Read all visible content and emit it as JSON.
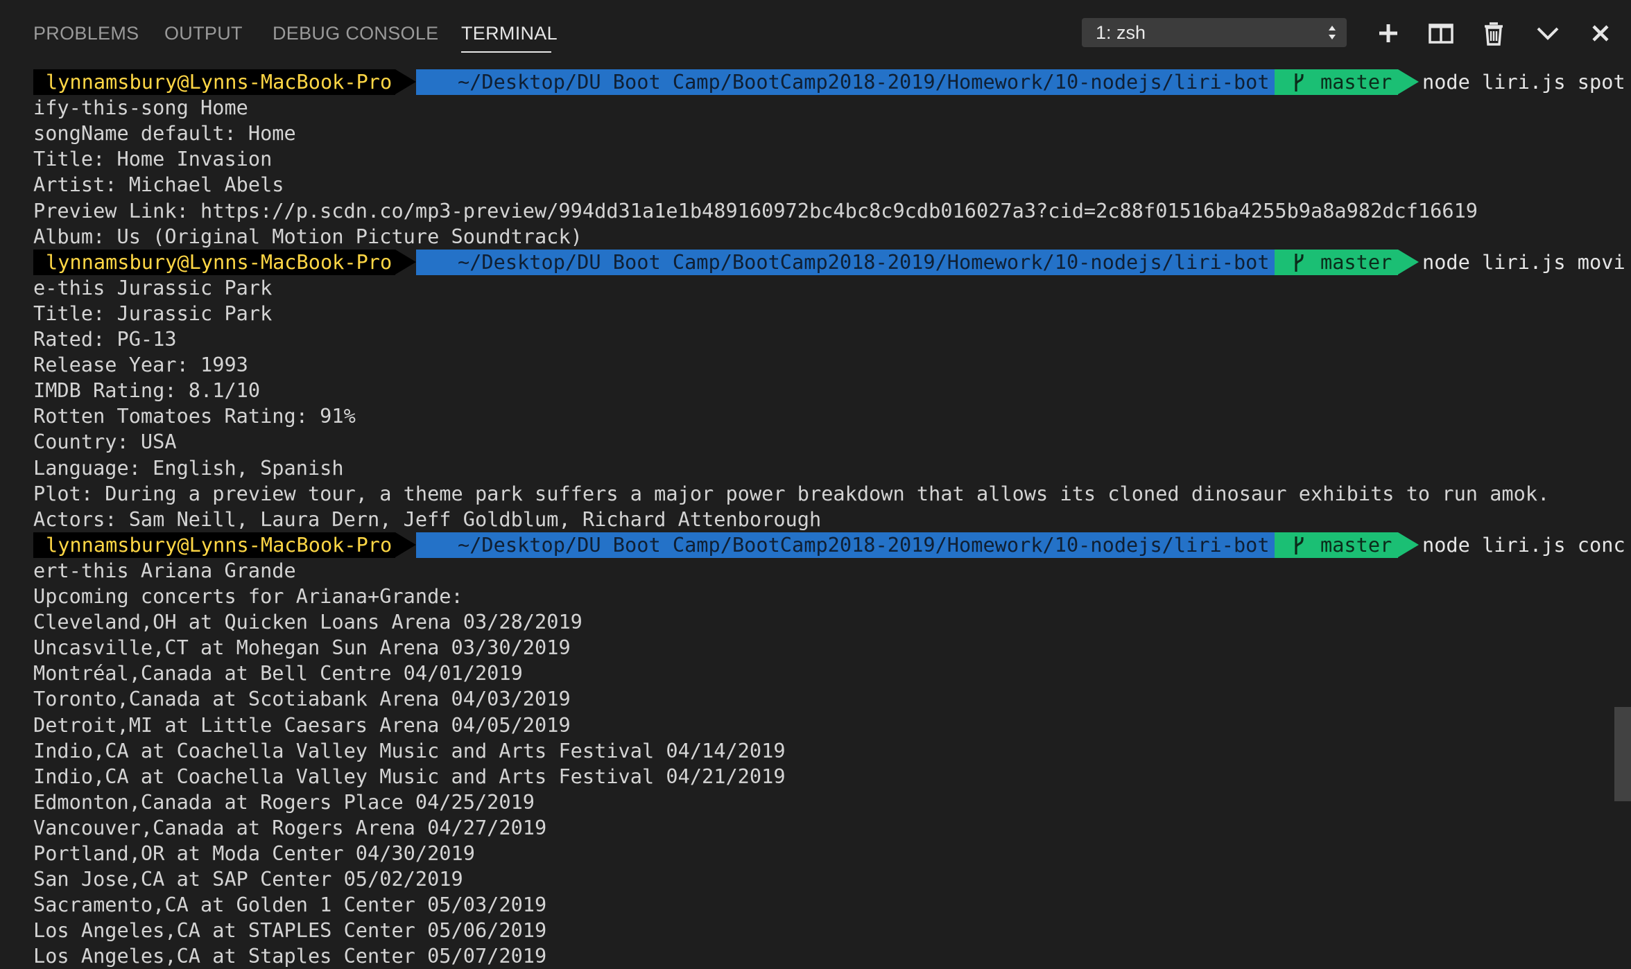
{
  "tabs": [
    {
      "label": "PROBLEMS",
      "active": false
    },
    {
      "label": "OUTPUT",
      "active": false
    },
    {
      "label": "DEBUG CONSOLE",
      "active": false
    },
    {
      "label": "TERMINAL",
      "active": true
    }
  ],
  "terminal_select": {
    "value": "1: zsh"
  },
  "toolbar_icons": [
    "plus-icon",
    "split-icon",
    "trash-icon",
    "chevron-down-icon",
    "close-icon"
  ],
  "prompt": {
    "user": "lynnamsbury@Lynns-MacBook-Pro",
    "path": "~/Desktop/DU Boot Camp/BootCamp2018-2019/Homework/10-nodejs/liri-bot",
    "branch": "master"
  },
  "colors": {
    "background": "#1e1e1e",
    "user_segment": "#000000",
    "user_text": "#ffd745",
    "path_segment": "#2472c8",
    "git_segment": "#1bbf74"
  },
  "blocks": [
    {
      "command": "node liri.js spot",
      "lines": [
        "ify-this-song Home",
        "songName default: Home",
        "Title: Home Invasion",
        "Artist: Michael Abels",
        "Preview Link: https://p.scdn.co/mp3-preview/994dd31a1e1b489160972bc4bc8c9cdb016027a3?cid=2c88f01516ba4255b9a8a982dcf16619",
        "Album: Us (Original Motion Picture Soundtrack)"
      ]
    },
    {
      "command": "node liri.js movi",
      "lines": [
        "e-this Jurassic Park",
        "Title: Jurassic Park",
        "Rated: PG-13",
        "Release Year: 1993",
        "IMDB Rating: 8.1/10",
        "Rotten Tomatoes Rating: 91%",
        "Country: USA",
        "Language: English, Spanish",
        "Plot: During a preview tour, a theme park suffers a major power breakdown that allows its cloned dinosaur exhibits to run amok.",
        "Actors: Sam Neill, Laura Dern, Jeff Goldblum, Richard Attenborough"
      ]
    },
    {
      "command": "node liri.js conc",
      "lines": [
        "ert-this Ariana Grande",
        "Upcoming concerts for Ariana+Grande:",
        "Cleveland,OH at Quicken Loans Arena 03/28/2019",
        "Uncasville,CT at Mohegan Sun Arena 03/30/2019",
        "Montréal,Canada at Bell Centre 04/01/2019",
        "Toronto,Canada at Scotiabank Arena 04/03/2019",
        "Detroit,MI at Little Caesars Arena 04/05/2019",
        "Indio,CA at Coachella Valley Music and Arts Festival 04/14/2019",
        "Indio,CA at Coachella Valley Music and Arts Festival 04/21/2019",
        "Edmonton,Canada at Rogers Place 04/25/2019",
        "Vancouver,Canada at Rogers Arena 04/27/2019",
        "Portland,OR at Moda Center 04/30/2019",
        "San Jose,CA at SAP Center 05/02/2019",
        "Sacramento,CA at Golden 1 Center 05/03/2019",
        "Los Angeles,CA at STAPLES Center 05/06/2019",
        "Los Angeles,CA at Staples Center 05/07/2019"
      ]
    }
  ]
}
